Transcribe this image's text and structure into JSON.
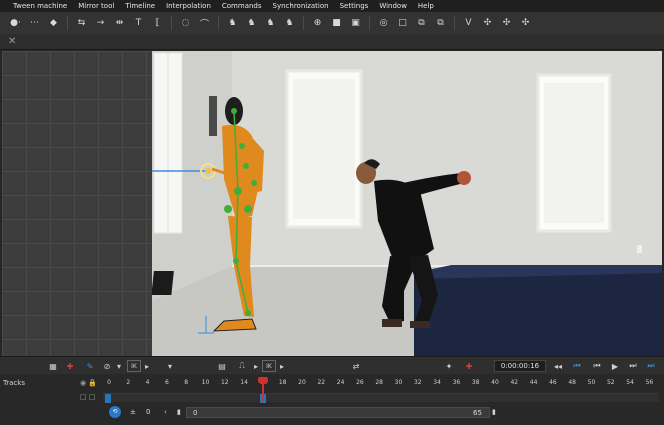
{
  "menu": [
    {
      "id": "tween-machine",
      "label": "Tween machine"
    },
    {
      "id": "mirror-tool",
      "label": "Mirror tool"
    },
    {
      "id": "timeline",
      "label": "Timeline"
    },
    {
      "id": "interpolation",
      "label": "Interpolation"
    },
    {
      "id": "commands",
      "label": "Commands"
    },
    {
      "id": "synchronization",
      "label": "Synchronization"
    },
    {
      "id": "settings",
      "label": "Settings"
    },
    {
      "id": "window",
      "label": "Window"
    },
    {
      "id": "help",
      "label": "Help"
    }
  ],
  "toolbar_icons": [
    "pose-dots-icon",
    "move-keys-icon",
    "eraser-icon",
    "swap-icon",
    "arrow-range-icon",
    "scale-keys-icon",
    "text-icon",
    "bracket-icon",
    "curve-icon",
    "ik-arc-icon",
    "run-pose-1-icon",
    "run-pose-2-icon",
    "run-pose-3-icon",
    "run-pose-4-icon",
    "target-icon",
    "camera-icon",
    "frame-icon",
    "spiral-icon",
    "square-icon",
    "copy-icon",
    "paste-icon",
    "v-logo-icon",
    "butterfly-1-icon",
    "butterfly-2-icon",
    "butterfly-3-icon"
  ],
  "controls": {
    "ik_label_1": "IK",
    "ik_label_2": "IK",
    "time": "0:00:00:16"
  },
  "timeline": {
    "tracks_label": "Tracks",
    "ticks": [
      "0",
      "2",
      "4",
      "6",
      "8",
      "10",
      "12",
      "14",
      "16",
      "18",
      "20",
      "22",
      "24",
      "26",
      "28",
      "30",
      "32",
      "34",
      "36",
      "38",
      "40",
      "42",
      "44",
      "46",
      "48",
      "50",
      "52",
      "54",
      "56"
    ],
    "current_frame": 16,
    "range_start": "0",
    "range_end": "65",
    "offset_value": "0"
  },
  "colors": {
    "accent": "#2a7ac8",
    "playhead": "#d03030",
    "rig": "#e08a1e",
    "rig_joint": "#3fae3a"
  }
}
